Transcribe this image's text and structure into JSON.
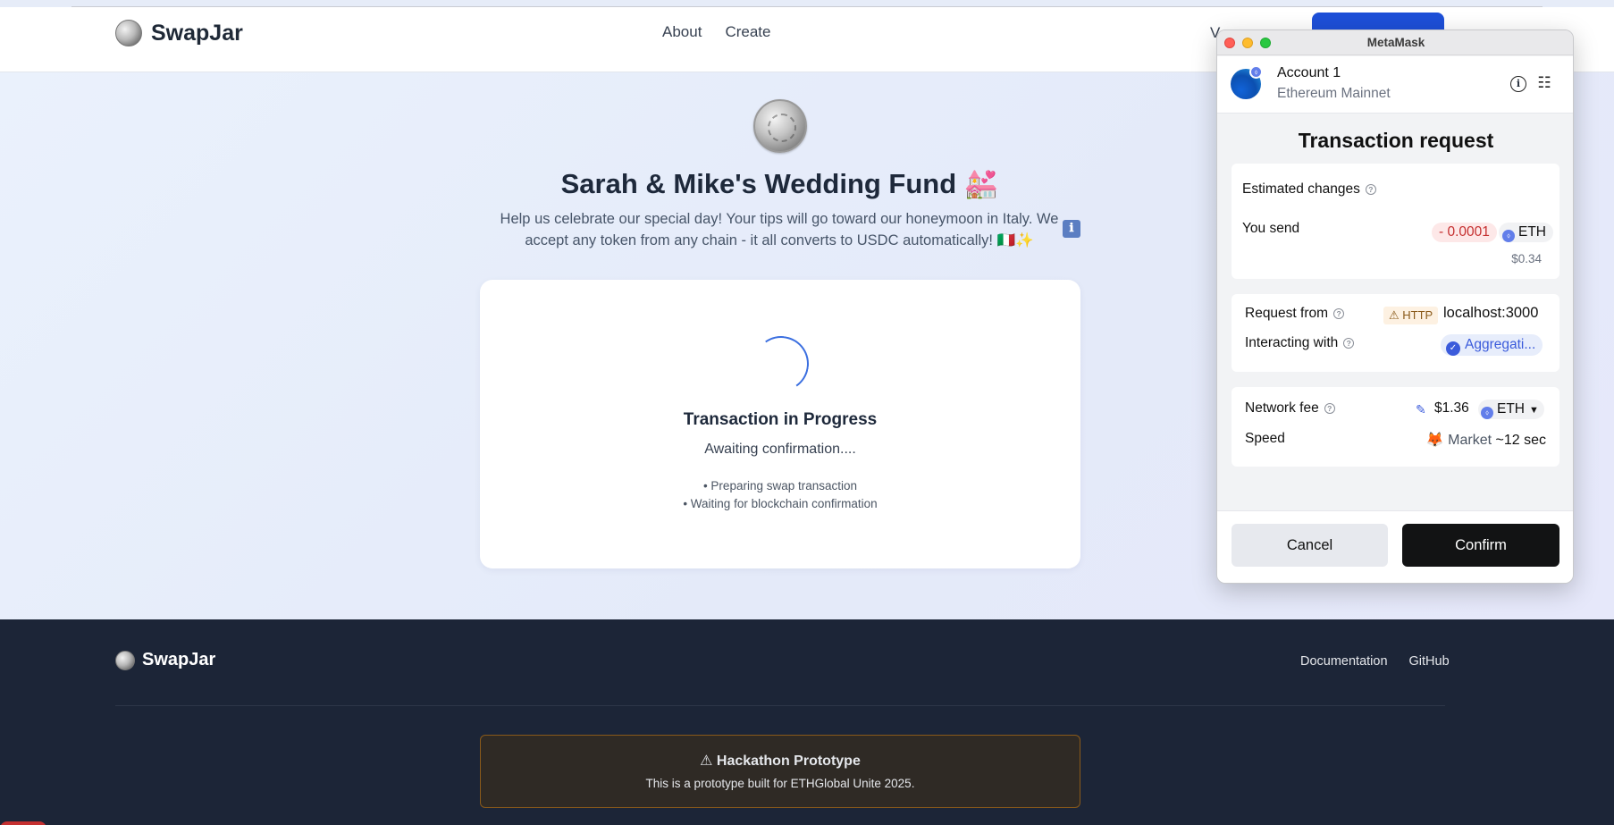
{
  "header": {
    "brand": "SwapJar",
    "nav": [
      "About",
      "Create"
    ],
    "partial_nav": "V"
  },
  "campaign": {
    "title": "Sarah & Mike's Wedding Fund 💒",
    "description": "Help us celebrate our special day! Your tips will go toward our honeymoon in Italy. We accept any token from any chain - it all converts to USDC automatically! 🇮🇹✨",
    "info_icon": "ℹ"
  },
  "transaction": {
    "title": "Transaction in Progress",
    "status": "Awaiting confirmation....",
    "steps": [
      "• Preparing swap transaction",
      "• Waiting for blockchain confirmation"
    ]
  },
  "footer": {
    "brand": "SwapJar",
    "links": [
      "Documentation",
      "GitHub"
    ],
    "notice_title": "⚠ Hackathon Prototype",
    "notice_text": "This is a prototype built for ETHGlobal Unite 2025."
  },
  "metamask": {
    "window_title": "MetaMask",
    "account_name": "Account 1",
    "network": "Ethereum Mainnet",
    "heading": "Transaction request",
    "estimated_changes_label": "Estimated changes",
    "you_send_label": "You send",
    "send_amount": "- 0.0001",
    "send_token": "ETH",
    "send_usd": "$0.34",
    "request_from_label": "Request from",
    "http_badge": "⚠ HTTP",
    "request_host": "localhost:3000",
    "interacting_with_label": "Interacting with",
    "interacting_with_value": "Aggregati...",
    "network_fee_label": "Network fee",
    "network_fee_usd": "$1.36",
    "network_fee_token": "ETH",
    "speed_label": "Speed",
    "speed_icon": "🦊",
    "speed_value": "Market",
    "speed_time": "~12 sec",
    "cancel_label": "Cancel",
    "confirm_label": "Confirm"
  },
  "colors": {
    "accent_blue": "#1d4fd8",
    "footer_bg": "#1c2537",
    "confirm_bg": "#121314",
    "negative_red": "#c53030"
  }
}
